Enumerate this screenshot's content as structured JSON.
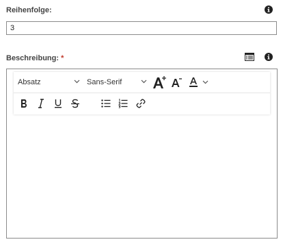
{
  "order": {
    "label": "Reihenfolge:",
    "value": "3"
  },
  "description": {
    "label": "Beschreibung:",
    "required_marker": "*"
  },
  "toolbar": {
    "block_format": {
      "value": "Absatz"
    },
    "font_family": {
      "value": "Sans-Serif"
    },
    "icons": [
      "font-size-increase-icon",
      "font-size-decrease-icon",
      "font-color-icon",
      "bold-icon",
      "italic-icon",
      "underline-icon",
      "strikethrough-icon",
      "bullet-list-icon",
      "numbered-list-icon",
      "link-icon"
    ]
  },
  "colors": {
    "border": "#8a8a8a",
    "label": "#444444",
    "required": "#c0392b",
    "icon": "#222222"
  }
}
